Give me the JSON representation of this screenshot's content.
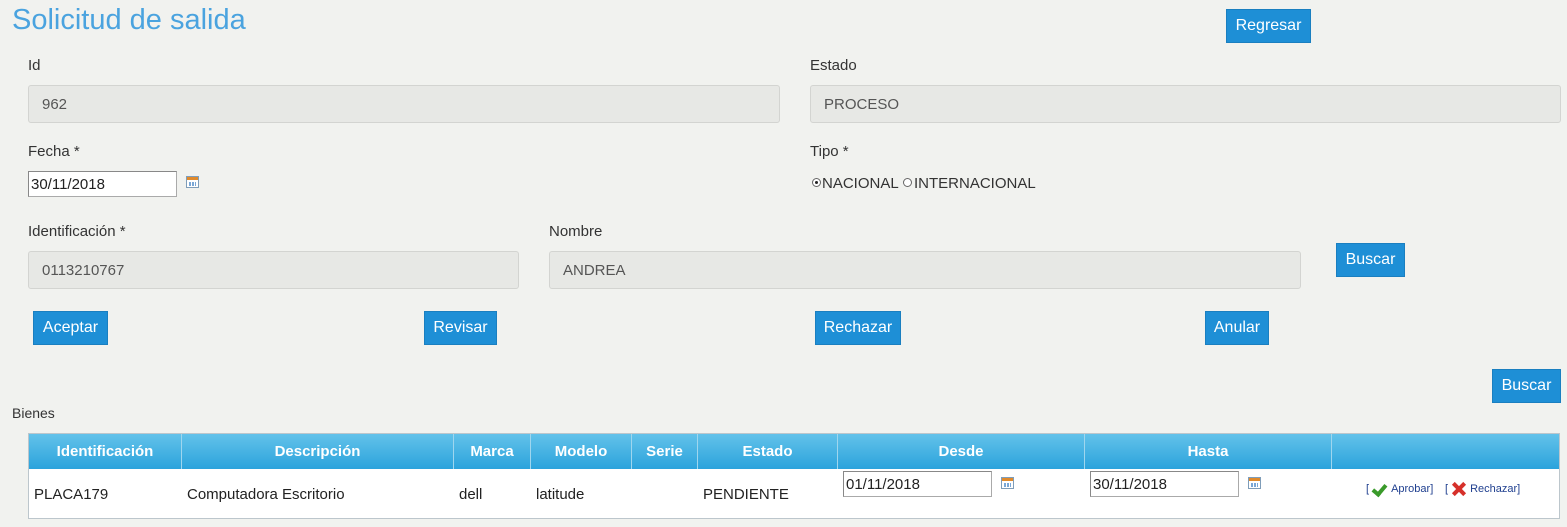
{
  "page": {
    "title": "Solicitud de salida"
  },
  "buttons": {
    "regresar": "Regresar",
    "buscar_persona": "Buscar",
    "aceptar": "Aceptar",
    "revisar": "Revisar",
    "rechazar": "Rechazar",
    "anular": "Anular",
    "buscar_bienes": "Buscar"
  },
  "form": {
    "id": {
      "label": "Id",
      "value": "962"
    },
    "estado": {
      "label": "Estado",
      "value": "PROCESO"
    },
    "fecha": {
      "label": "Fecha *",
      "value": "30/11/2018",
      "icon": "calendar-icon"
    },
    "tipo": {
      "label": "Tipo *",
      "options": [
        {
          "label": "NACIONAL",
          "selected": true
        },
        {
          "label": "INTERNACIONAL",
          "selected": false
        }
      ]
    },
    "identificacion": {
      "label": "Identificación *",
      "value": "0113210767"
    },
    "nombre": {
      "label": "Nombre",
      "value": "ANDREA"
    }
  },
  "bienes": {
    "label": "Bienes",
    "columns": [
      "Identificación",
      "Descripción",
      "Marca",
      "Modelo",
      "Serie",
      "Estado",
      "Desde",
      "Hasta",
      ""
    ],
    "rows": [
      {
        "identificacion": "PLACA179",
        "descripcion": "Computadora Escritorio",
        "marca": "dell",
        "modelo": "latitude",
        "serie": "",
        "estado": "PENDIENTE",
        "desde": "01/11/2018",
        "hasta": "30/11/2018",
        "aprobar": "Aprobar",
        "rechazar": "Rechazar",
        "open_bracket": "[",
        "close_bracket": "]"
      }
    ]
  },
  "colors": {
    "accent": "#1e8fd6",
    "title": "#4aa3df",
    "header": "#2ba3dc"
  }
}
